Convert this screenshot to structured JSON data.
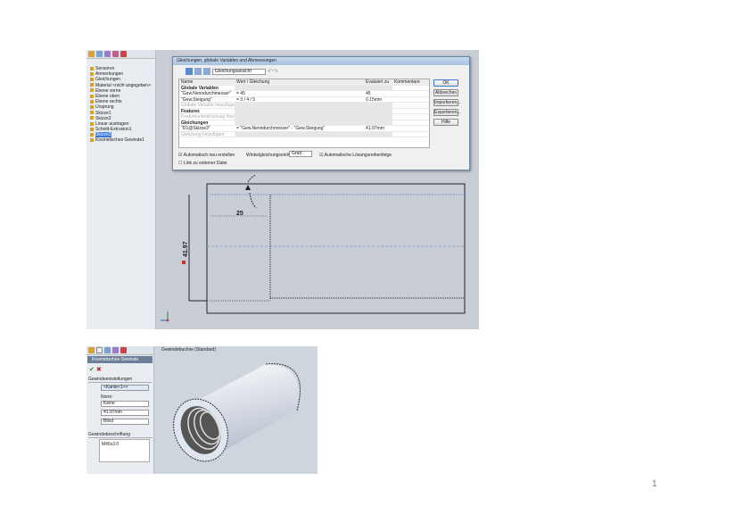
{
  "page_number": "1",
  "screenshot1": {
    "tree": [
      "Sensoren",
      "Anmerkungen",
      "Gleichungen",
      "Material <nicht angegeben>",
      "Ebene vorne",
      "Ebene oben",
      "Ebene rechts",
      "Ursprung",
      "Skizze1",
      "Skizze2",
      "Linear austragen",
      "Schnitt-Extrusion1",
      "Skizze3",
      "Kosmetisches Gewinde1"
    ],
    "selected_tree_index": 12,
    "dialog": {
      "title": "Gleichungen, globale Variablen und Abmessungen",
      "view_select": "Gleichungsansicht",
      "columns": [
        "Name",
        "Wert / Gleichung",
        "Evaluiert zu",
        "Kommentare"
      ],
      "rows": [
        {
          "name": "Globale Variablen",
          "value": "",
          "eval": "",
          "type": "section"
        },
        {
          "name": "\"Gew.Nenndurchmesser\"",
          "value": "= 45",
          "eval": "45",
          "type": "data"
        },
        {
          "name": "\"Gew.Steigung\"",
          "value": "= 3 / 4 / 5",
          "eval": "0.15mm",
          "type": "data"
        },
        {
          "name": "Globale Variable hinzufügen",
          "value": "",
          "eval": "",
          "type": "hint"
        },
        {
          "name": "Features",
          "value": "",
          "eval": "",
          "type": "section"
        },
        {
          "name": "Featureunterdrückung hinzufügen",
          "value": "",
          "eval": "",
          "type": "hint"
        },
        {
          "name": "Gleichungen",
          "value": "",
          "eval": "",
          "type": "section"
        },
        {
          "name": "\"D1@Skizze3\"",
          "value": "= \"Gew.Nenndurchmesser\" - \"Gew.Steigung\"",
          "eval": "41.97mm",
          "type": "data"
        },
        {
          "name": "Gleichung hinzufügen",
          "value": "",
          "eval": "",
          "type": "hint"
        }
      ],
      "buttons": [
        "OK",
        "Abbrechen",
        "Importieren...",
        "Exportieren...",
        "Hilfe"
      ],
      "auto_rebuild": "Automatisch neu erstellen",
      "angle_units_label": "Winkelgleichungseinheiten:",
      "angle_units_value": "Grad",
      "auto_order": "Automatische Lösungsreihenfolge",
      "link_file": "Link zu externer Datei"
    },
    "dimensions": {
      "horizontal": "25",
      "vertical": "41.97"
    }
  },
  "screenshot2": {
    "panel_title": "Kosmetisches Gewinde",
    "section_settings": "Gewindeeinstellungen",
    "edge_value": "<Kante<1>>",
    "standard_label": "Norm:",
    "standard_value": "Keine",
    "diameter_value": "41.97mm",
    "end_condition": "Blind",
    "section_callout": "Gewindebeschriftung",
    "callout_value": "M45x3.0",
    "tree_label": "Gewindebuchse (Standard)"
  }
}
